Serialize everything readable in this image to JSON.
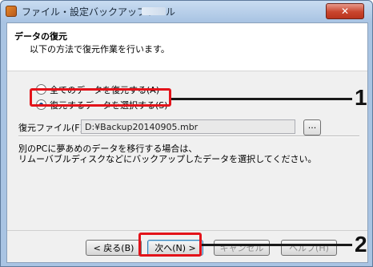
{
  "window": {
    "title": "ファイル・設定バックアップツール",
    "close_glyph": "✕"
  },
  "header": {
    "title": "データの復元",
    "subtitle": "以下の方法で復元作業を行います。"
  },
  "options": [
    {
      "label": "全てのデータを復元する(A)",
      "selected": false
    },
    {
      "label": "復元するデータを選択する(S)",
      "selected": true
    }
  ],
  "restore_file": {
    "label": "復元ファイル(F)",
    "value": "D:¥Backup20140905.mbr",
    "browse_label": "..."
  },
  "note": {
    "line1": "別のPCに夢あめのデータを移行する場合は、",
    "line2": "リムーバブルディスクなどにバックアップしたデータを選択してください。"
  },
  "buttons": {
    "back": "< 戻る(B)",
    "next": "次へ(N) >",
    "cancel": "キャンセル",
    "help": "ヘルプ(H)"
  },
  "callouts": {
    "one": "1",
    "two": "2",
    "color": "#e3131a"
  },
  "icons": {
    "app": "app-icon",
    "close": "close-icon"
  }
}
